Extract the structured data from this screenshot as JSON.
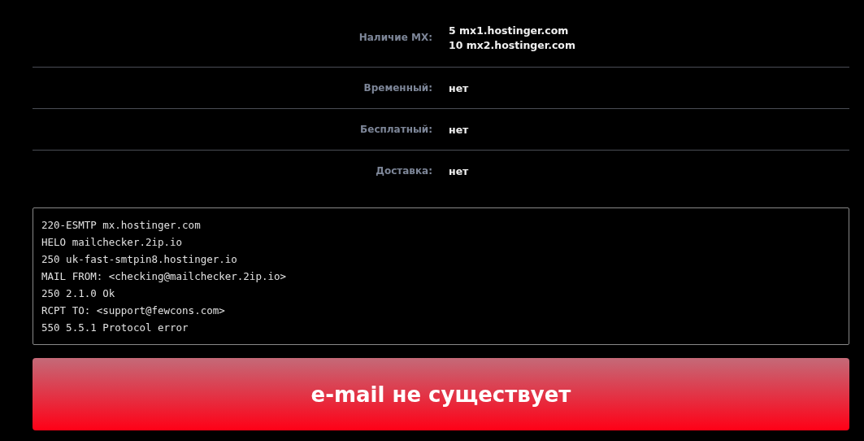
{
  "details": [
    {
      "label": "Наличие MX:",
      "values": [
        "5 mx1.hostinger.com",
        "10 mx2.hostinger.com"
      ]
    },
    {
      "label": "Временный:",
      "values": [
        "нет"
      ]
    },
    {
      "label": "Бесплатный:",
      "values": [
        "нет"
      ]
    },
    {
      "label": "Доставка:",
      "values": [
        "нет"
      ]
    }
  ],
  "smtp_log": [
    "220-ESMTP mx.hostinger.com",
    "HELO mailchecker.2ip.io",
    "250 uk-fast-smtpin8.hostinger.io",
    "MAIL FROM: <checking@mailchecker.2ip.io>",
    "250 2.1.0 Ok",
    "RCPT TO: <support@fewcons.com>",
    "550 5.5.1 Protocol error"
  ],
  "result": {
    "text": "e-mail не существует",
    "success": false
  }
}
